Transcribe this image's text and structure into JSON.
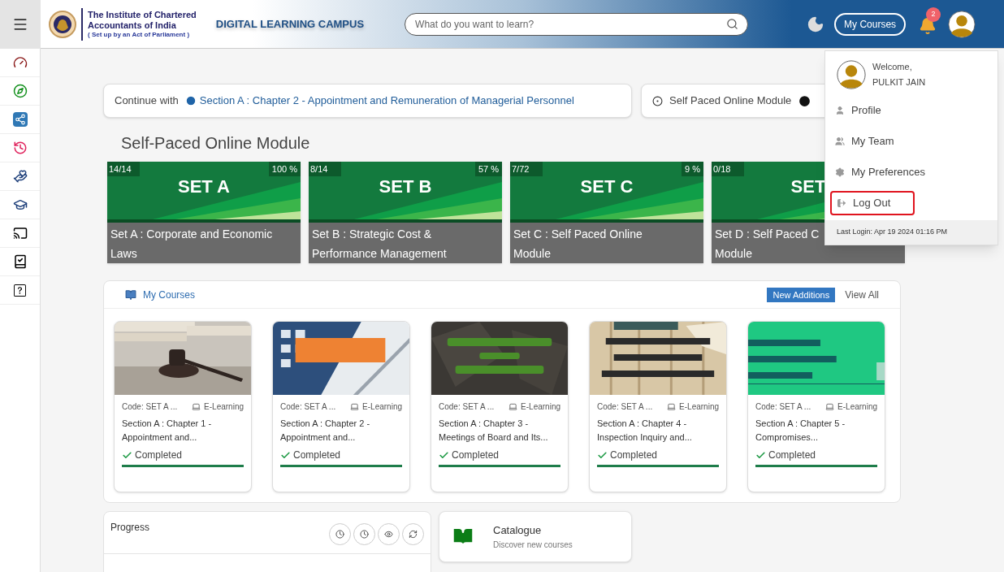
{
  "header": {
    "institute_lines": [
      "The Institute of Chartered",
      "Accountants of India"
    ],
    "institute_subtitle": "( Set up by an Act of Parliament )",
    "campus_title": "DIGITAL LEARNING CAMPUS",
    "search": {
      "placeholder": "What do you want to learn?"
    },
    "my_courses_button": "My Courses",
    "notification_count": "2"
  },
  "continue": {
    "label": "Continue with",
    "link": "Section A : Chapter 2 - Appointment and Remuneration of Managerial Personnel"
  },
  "module_pill": {
    "label": "Self Paced Online Module"
  },
  "section_title": "Self-Paced Online Module",
  "sets": [
    {
      "count": "14/14",
      "percent": "100 %",
      "banner": "SET A",
      "title_lines": [
        "Set A : Corporate and Economic",
        "Laws"
      ]
    },
    {
      "count": "8/14",
      "percent": "57 %",
      "banner": "SET B",
      "title_lines": [
        "Set B : Strategic Cost &",
        "Performance Management"
      ]
    },
    {
      "count": "7/72",
      "percent": "9 %",
      "banner": "SET C",
      "title_lines": [
        "Set C : Self Paced Online",
        "Module"
      ]
    },
    {
      "count": "0/18",
      "banner": "SET",
      "title_lines": [
        "Set D : Self Paced C",
        "Module"
      ]
    }
  ],
  "my_courses": {
    "title": "My Courses",
    "new_additions": "New Additions",
    "view_all": "View All",
    "courses": [
      {
        "code": "Code: SET A ...",
        "type": "E-Learning",
        "title_lines": [
          "Section A : Chapter 1 -",
          "Appointment and..."
        ],
        "status": "Completed",
        "completed": true
      },
      {
        "code": "Code: SET A ...",
        "type": "E-Learning",
        "title_lines": [
          "Section A : Chapter 2 -",
          "Appointment and..."
        ],
        "status": "Completed",
        "completed": true
      },
      {
        "code": "Code: SET A ...",
        "type": "E-Learning",
        "title_lines": [
          "Section A : Chapter 3 -",
          "Meetings of Board and Its..."
        ],
        "status": "Completed",
        "completed": true
      },
      {
        "code": "Code: SET A ...",
        "type": "E-Learning",
        "title_lines": [
          "Section A : Chapter 4 -",
          "Inspection Inquiry and..."
        ],
        "status": "Completed",
        "completed": true
      },
      {
        "code": "Code: SET A ...",
        "type": "E-Learning",
        "title_lines": [
          "Section A : Chapter 5 -",
          "Compromises..."
        ],
        "status": "Completed",
        "completed": true
      }
    ]
  },
  "progress": {
    "title": "Progress"
  },
  "catalogue": {
    "title": "Catalogue",
    "subtitle": "Discover new courses"
  },
  "user_menu": {
    "welcome": "Welcome,",
    "name": "PULKIT JAIN",
    "items": [
      {
        "label": "Profile",
        "highlighted": false
      },
      {
        "label": "My Team",
        "highlighted": false
      },
      {
        "label": "My Preferences",
        "highlighted": false
      },
      {
        "label": "Log Out",
        "highlighted": true
      }
    ],
    "last_login": "Last Login: Apr 19 2024 01:16 PM"
  }
}
